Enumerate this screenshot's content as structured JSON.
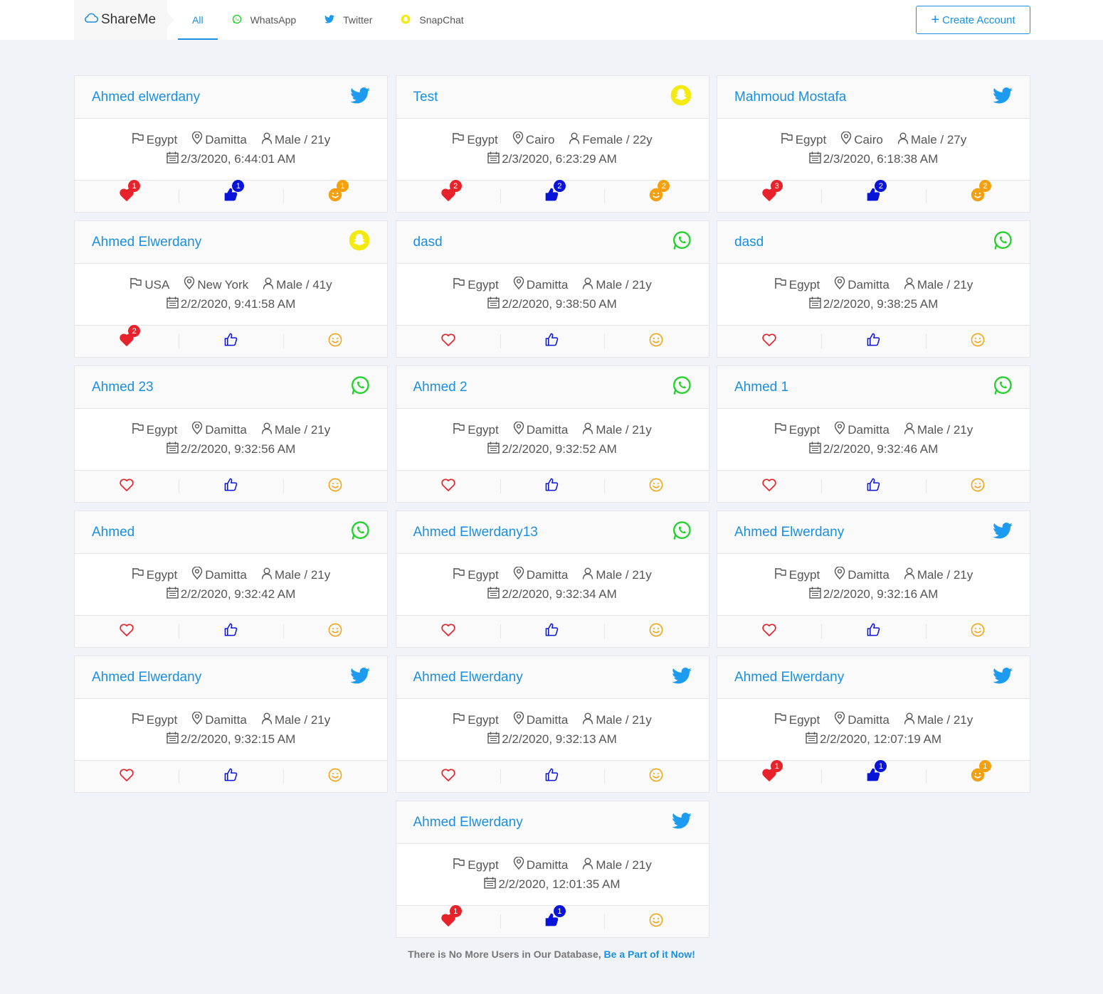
{
  "brand": {
    "name": "ShareMe"
  },
  "nav": {
    "tabs": [
      {
        "label": "All",
        "icon": ""
      },
      {
        "label": "WhatsApp",
        "icon": "whatsapp"
      },
      {
        "label": "Twitter",
        "icon": "twitter"
      },
      {
        "label": "SnapChat",
        "icon": "snapchat"
      }
    ],
    "active_tab": "All"
  },
  "create_button": {
    "label": "Create Account"
  },
  "colors": {
    "accent": "#1a8fe3",
    "heart": "#e8222b",
    "like": "#0a14d9",
    "smile": "#f5a00f",
    "whatsapp": "#25d02d",
    "twitter": "#1d9bf0",
    "snapchat": "#f3ea13"
  },
  "cards": [
    {
      "name": "Ahmed elwerdany",
      "platform": "twitter",
      "country": "Egypt",
      "city": "Damitta",
      "gender_age": "Male / 21y",
      "date": "2/3/2020, 6:44:01 AM",
      "hearts": "1",
      "likes": "1",
      "smiles": "1"
    },
    {
      "name": "Test",
      "platform": "snapchat",
      "country": "Egypt",
      "city": "Cairo",
      "gender_age": "Female / 22y",
      "date": "2/3/2020, 6:23:29 AM",
      "hearts": "2",
      "likes": "2",
      "smiles": "2"
    },
    {
      "name": "Mahmoud Mostafa",
      "platform": "twitter",
      "country": "Egypt",
      "city": "Cairo",
      "gender_age": "Male / 27y",
      "date": "2/3/2020, 6:18:38 AM",
      "hearts": "3",
      "likes": "2",
      "smiles": "2"
    },
    {
      "name": "Ahmed Elwerdany",
      "platform": "snapchat",
      "country": "USA",
      "city": "New York",
      "gender_age": "Male / 41y",
      "date": "2/2/2020, 9:41:58 AM",
      "hearts": "2",
      "likes": "",
      "smiles": ""
    },
    {
      "name": "dasd",
      "platform": "whatsapp",
      "country": "Egypt",
      "city": "Damitta",
      "gender_age": "Male / 21y",
      "date": "2/2/2020, 9:38:50 AM",
      "hearts": "",
      "likes": "",
      "smiles": ""
    },
    {
      "name": "dasd",
      "platform": "whatsapp",
      "country": "Egypt",
      "city": "Damitta",
      "gender_age": "Male / 21y",
      "date": "2/2/2020, 9:38:25 AM",
      "hearts": "",
      "likes": "",
      "smiles": ""
    },
    {
      "name": "Ahmed 23",
      "platform": "whatsapp",
      "country": "Egypt",
      "city": "Damitta",
      "gender_age": "Male / 21y",
      "date": "2/2/2020, 9:32:56 AM",
      "hearts": "",
      "likes": "",
      "smiles": ""
    },
    {
      "name": "Ahmed 2",
      "platform": "whatsapp",
      "country": "Egypt",
      "city": "Damitta",
      "gender_age": "Male / 21y",
      "date": "2/2/2020, 9:32:52 AM",
      "hearts": "",
      "likes": "",
      "smiles": ""
    },
    {
      "name": "Ahmed 1",
      "platform": "whatsapp",
      "country": "Egypt",
      "city": "Damitta",
      "gender_age": "Male / 21y",
      "date": "2/2/2020, 9:32:46 AM",
      "hearts": "",
      "likes": "",
      "smiles": ""
    },
    {
      "name": "Ahmed",
      "platform": "whatsapp",
      "country": "Egypt",
      "city": "Damitta",
      "gender_age": "Male / 21y",
      "date": "2/2/2020, 9:32:42 AM",
      "hearts": "",
      "likes": "",
      "smiles": ""
    },
    {
      "name": "Ahmed Elwerdany13",
      "platform": "whatsapp",
      "country": "Egypt",
      "city": "Damitta",
      "gender_age": "Male / 21y",
      "date": "2/2/2020, 9:32:34 AM",
      "hearts": "",
      "likes": "",
      "smiles": ""
    },
    {
      "name": "Ahmed Elwerdany",
      "platform": "twitter",
      "country": "Egypt",
      "city": "Damitta",
      "gender_age": "Male / 21y",
      "date": "2/2/2020, 9:32:16 AM",
      "hearts": "",
      "likes": "",
      "smiles": ""
    },
    {
      "name": "Ahmed Elwerdany",
      "platform": "twitter",
      "country": "Egypt",
      "city": "Damitta",
      "gender_age": "Male / 21y",
      "date": "2/2/2020, 9:32:15 AM",
      "hearts": "",
      "likes": "",
      "smiles": ""
    },
    {
      "name": "Ahmed Elwerdany",
      "platform": "twitter",
      "country": "Egypt",
      "city": "Damitta",
      "gender_age": "Male / 21y",
      "date": "2/2/2020, 9:32:13 AM",
      "hearts": "",
      "likes": "",
      "smiles": ""
    },
    {
      "name": "Ahmed Elwerdany",
      "platform": "twitter",
      "country": "Egypt",
      "city": "Damitta",
      "gender_age": "Male / 21y",
      "date": "2/2/2020, 12:07:19 AM",
      "hearts": "1",
      "likes": "1",
      "smiles": "1"
    },
    {
      "name": "Ahmed Elwerdany",
      "platform": "twitter",
      "country": "Egypt",
      "city": "Damitta",
      "gender_age": "Male / 21y",
      "date": "2/2/2020, 12:01:35 AM",
      "hearts": "1",
      "likes": "1",
      "smiles": ""
    }
  ],
  "footer": {
    "text": "There is No More Users in Our Database, ",
    "link": "Be a Part of it Now!"
  }
}
